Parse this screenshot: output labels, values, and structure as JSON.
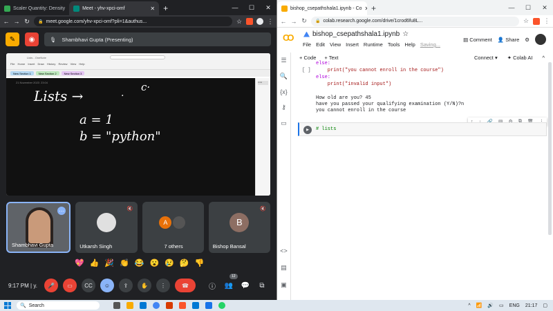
{
  "left_window": {
    "tabs": [
      {
        "label": "Scaler Quantity: Density",
        "color": "#34a853"
      },
      {
        "label": "Meet - yhv-xpci-omf",
        "color": "#00897b"
      }
    ],
    "new_tab": "+",
    "url": "meet.google.com/yhv-xpci-omf?pli=1&authus...",
    "presenter": "Shambhavi Gupta (Presenting)",
    "onenote": {
      "date": "21 November 2023",
      "time": "23:04",
      "tabs": [
        "Lists - OneNote",
        "New Section 1",
        "New Section 2",
        "New Section 3"
      ],
      "menu": "File Home Insert Draw History Review View Help",
      "search": "Search",
      "page": "Lists"
    },
    "handwriting": {
      "title": "Lists →",
      "dot": ".",
      "c": "c·",
      "a": "a = 1",
      "b": "b = \"python\""
    },
    "participants": [
      {
        "name": "Shambhavi Gupta"
      },
      {
        "name": "Utkarsh Singh"
      },
      {
        "name": "7 others",
        "initial": "A"
      },
      {
        "name": "Bishop Bansal",
        "initial": "B"
      }
    ],
    "reactions": [
      "💖",
      "👍",
      "🎉",
      "👏",
      "😂",
      "😮",
      "😢",
      "🤔",
      "👎"
    ],
    "time": "9:17 PM",
    "meeting_code_short": "y.",
    "people_count": "12"
  },
  "right_window": {
    "tabs": [
      {
        "label": "bishop_csepathshala1.ipynb - Co",
        "color": "#f9ab00"
      }
    ],
    "new_tab": "+",
    "url": "colab.research.google.com/drive/1crod6fu8L...",
    "notebook_title": "bishop_csepathshala1.ipynb",
    "menu": [
      "File",
      "Edit",
      "View",
      "Insert",
      "Runtime",
      "Tools",
      "Help"
    ],
    "saving": "Saving...",
    "comment": "Comment",
    "share": "Share",
    "add_code": "+ Code",
    "add_text": "+ Text",
    "connect": "Connect",
    "colab_ai": "Colab AI",
    "cell_bracket": "[ ]",
    "code_lines": [
      "else:",
      "    print(\"you cannot enroll in the course\")",
      "else:",
      "    print(\"invalid input\")"
    ],
    "output": "How old are you? 45\nhave you passed your qualifying examination (Y/N)?n\nyou cannot enroll in the course",
    "cell2_code": "# lists"
  },
  "taskbar": {
    "search": "Search",
    "lang": "ENG",
    "clock": "21:17"
  }
}
